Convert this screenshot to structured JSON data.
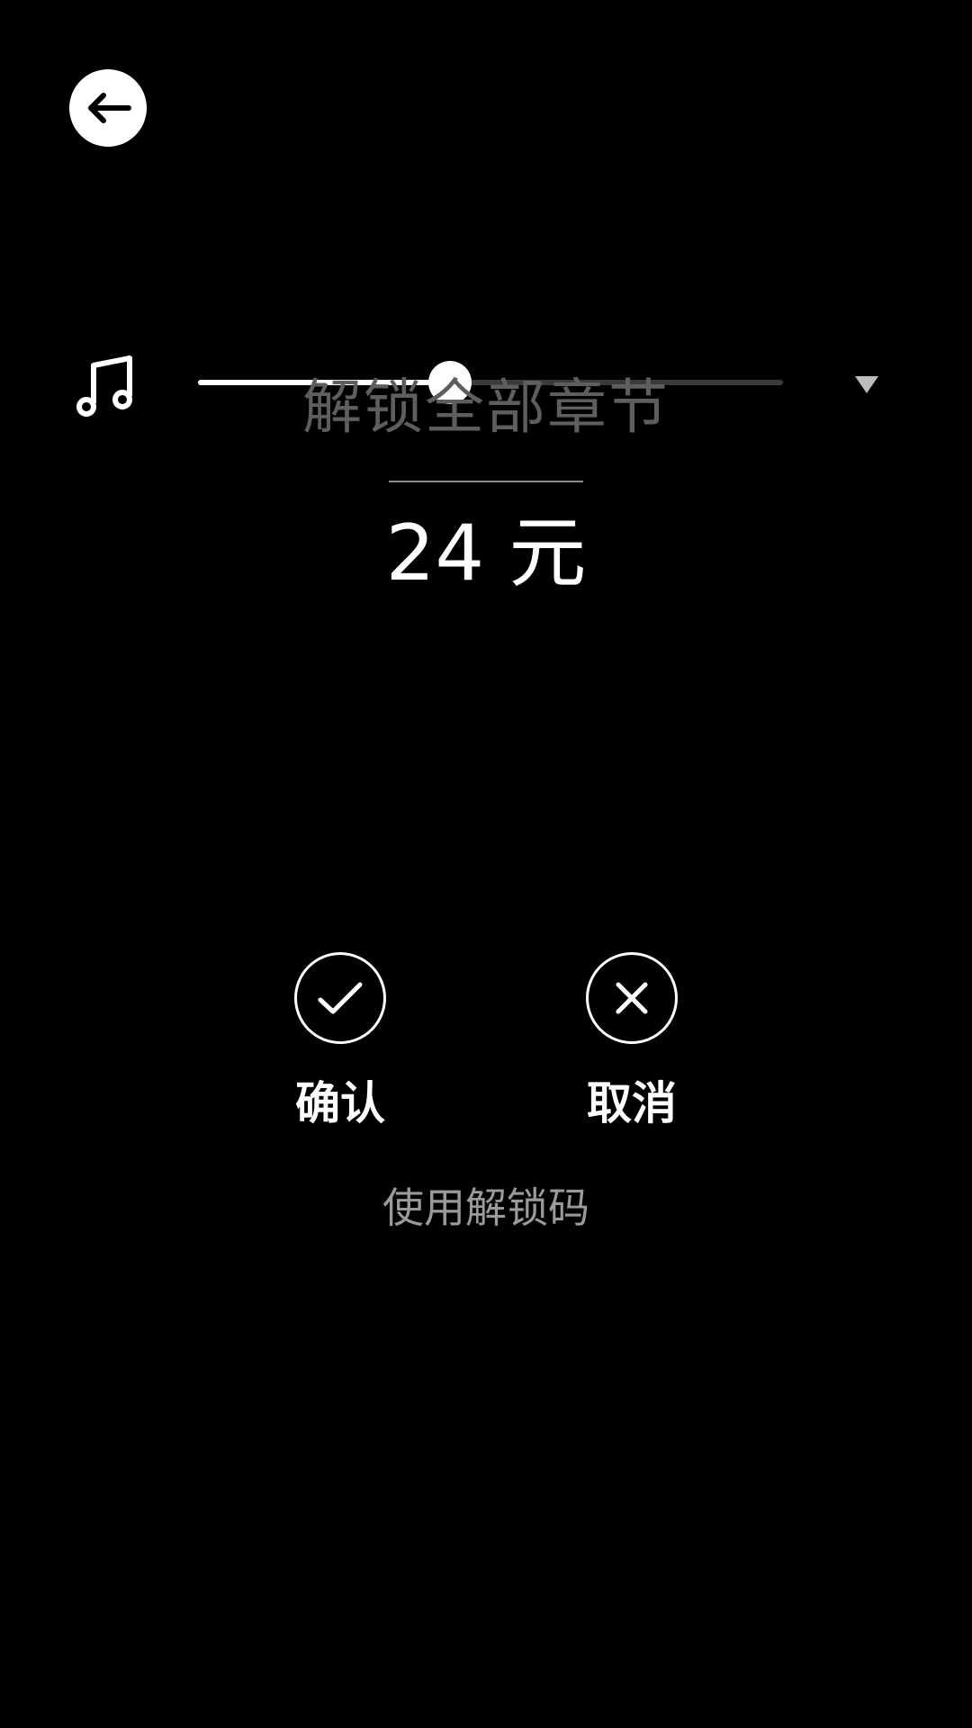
{
  "header": {
    "back_icon": "arrow-left-icon"
  },
  "audio": {
    "music_icon": "music-note-icon",
    "progress": 0.43,
    "dropdown_icon": "triangle-down-icon"
  },
  "dialog": {
    "title": "解锁全部章节",
    "price": "24 元"
  },
  "actions": {
    "confirm_label": "确认",
    "confirm_icon": "check-icon",
    "cancel_label": "取消",
    "cancel_icon": "close-icon"
  },
  "footer": {
    "unlock_code_label": "使用解锁码"
  },
  "colors": {
    "background": "#000000",
    "foreground": "#ffffff",
    "title_gray": "#5e5e5e",
    "link_gray": "#9a9a9a"
  }
}
